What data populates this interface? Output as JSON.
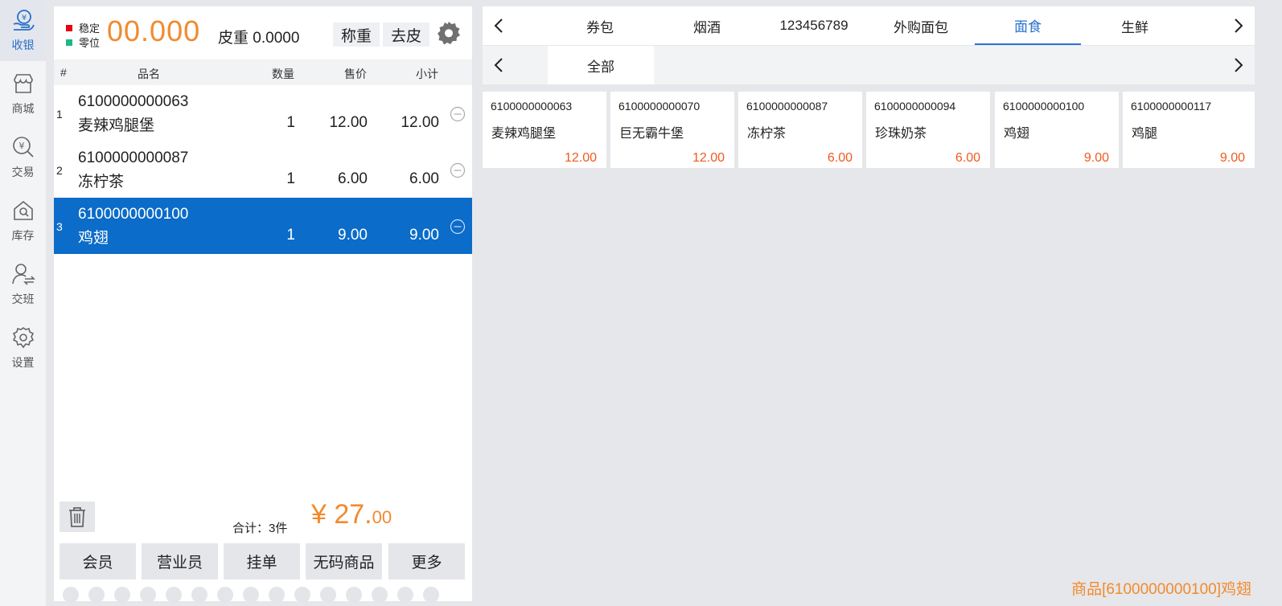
{
  "nav": {
    "items": [
      {
        "label": "收银",
        "icon": "cashier-icon",
        "active": true
      },
      {
        "label": "商城",
        "icon": "store-icon"
      },
      {
        "label": "交易",
        "icon": "transaction-search-icon"
      },
      {
        "label": "库存",
        "icon": "inventory-icon"
      },
      {
        "label": "交班",
        "icon": "shift-handover-icon"
      },
      {
        "label": "设置",
        "icon": "gear-icon"
      }
    ]
  },
  "scale": {
    "stable_label": "稳定",
    "zero_label": "零位",
    "stable_color": "#e60012",
    "zero_color": "#1fb884",
    "weight": "00.000",
    "tare": "皮重 0.0000",
    "weigh_button": "称重",
    "tare_button": "去皮"
  },
  "cart": {
    "headers": {
      "index": "#",
      "name": "品名",
      "qty": "数量",
      "price": "售价",
      "subtotal": "小计"
    },
    "rows": [
      {
        "index": "1",
        "code": "6100000000063",
        "name": "麦辣鸡腿堡",
        "qty": "1",
        "price": "12.00",
        "subtotal": "12.00",
        "selected": false
      },
      {
        "index": "2",
        "code": "6100000000087",
        "name": "冻柠茶",
        "qty": "1",
        "price": "6.00",
        "subtotal": "6.00",
        "selected": false
      },
      {
        "index": "3",
        "code": "6100000000100",
        "name": "鸡翅",
        "qty": "1",
        "price": "9.00",
        "subtotal": "9.00",
        "selected": true
      }
    ],
    "total_label": "合计：3件",
    "total_integer": "¥ 27.",
    "total_cents": "00"
  },
  "actions": {
    "member": "会员",
    "salesperson": "营业员",
    "hold": "挂单",
    "no_barcode": "无码商品",
    "more": "更多"
  },
  "categories": {
    "tabs": [
      "券包",
      "烟酒",
      "123456789",
      "外购面包",
      "面食",
      "生鲜"
    ],
    "active_index": 4,
    "subtabs": [
      "全部"
    ]
  },
  "products": [
    {
      "code": "6100000000063",
      "name": "麦辣鸡腿堡",
      "price": "12.00"
    },
    {
      "code": "6100000000070",
      "name": "巨无霸牛堡",
      "price": "12.00"
    },
    {
      "code": "6100000000087",
      "name": "冻柠茶",
      "price": "6.00"
    },
    {
      "code": "6100000000094",
      "name": "珍珠奶茶",
      "price": "6.00"
    },
    {
      "code": "6100000000100",
      "name": "鸡翅",
      "price": "9.00"
    },
    {
      "code": "6100000000117",
      "name": "鸡腿",
      "price": "9.00"
    }
  ],
  "status": {
    "message": "商品[6100000000100]鸡翅"
  }
}
